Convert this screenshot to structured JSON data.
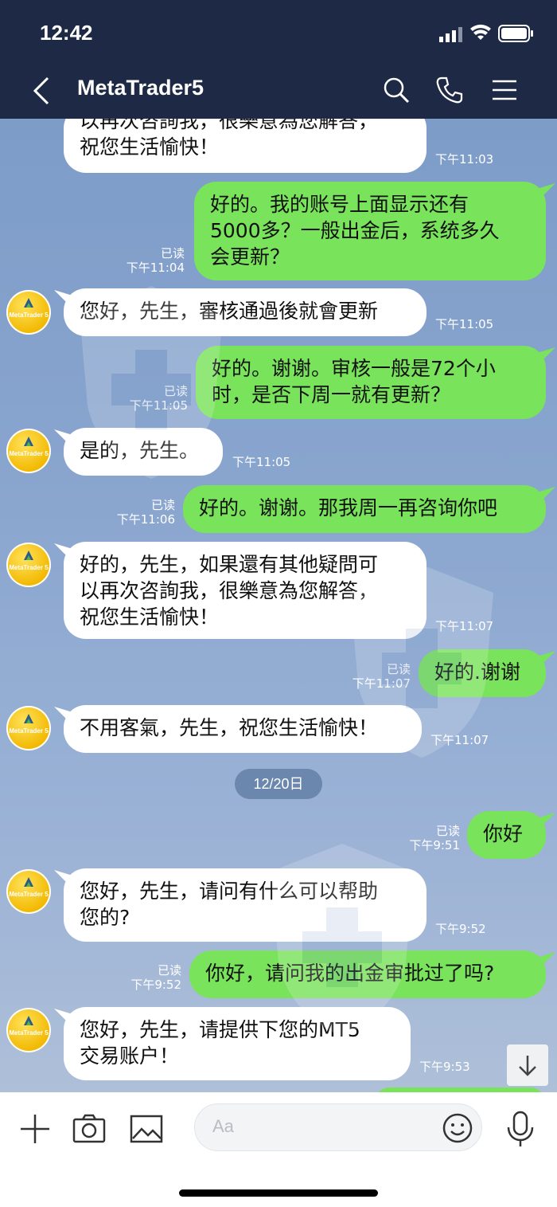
{
  "status_bar": {
    "time": "12:42"
  },
  "header": {
    "title": "MetaTrader5"
  },
  "avatar_text": "MetaTrader 5",
  "messages": [
    {
      "id": 0,
      "side": "in",
      "text": "以再次咨詢我，很樂意為您解答，\n祝您生活愉快！",
      "time": "下午11:03",
      "read": ""
    },
    {
      "id": 1,
      "side": "out",
      "text": "好的。我的账号上面显示还有\n5000多？一般出金后，系统多久\n会更新？",
      "time": "下午11:04",
      "read": "已读"
    },
    {
      "id": 2,
      "side": "in",
      "text": "您好，先生，審核通過後就會更新",
      "time": "下午11:05",
      "read": ""
    },
    {
      "id": 3,
      "side": "out",
      "text": "好的。谢谢。审核一般是72个小\n时，是否下周一就有更新？",
      "time": "下午11:05",
      "read": "已读"
    },
    {
      "id": 4,
      "side": "in",
      "text": "是的，先生。",
      "time": "下午11:05",
      "read": ""
    },
    {
      "id": 5,
      "side": "out",
      "text": "好的。谢谢。那我周一再咨询你吧",
      "time": "下午11:06",
      "read": "已读"
    },
    {
      "id": 6,
      "side": "in",
      "text": "好的，先生，如果還有其他疑問可\n以再次咨詢我，很樂意為您解答，\n祝您生活愉快！",
      "time": "下午11:07",
      "read": ""
    },
    {
      "id": 7,
      "side": "out",
      "text": "好的.谢谢",
      "time": "下午11:07",
      "read": "已读"
    },
    {
      "id": 8,
      "side": "in",
      "text": "不用客氣，先生，祝您生活愉快！",
      "time": "下午11:07",
      "read": ""
    },
    {
      "id": 9,
      "side": "out",
      "text": "你好",
      "time": "下午9:51",
      "read": "已读"
    },
    {
      "id": 10,
      "side": "in",
      "text": "您好，先生，请问有什么可以帮助\n您的?",
      "time": "下午9:52",
      "read": ""
    },
    {
      "id": 11,
      "side": "out",
      "text": "你好，请问我的出金审批过了吗?",
      "time": "下午9:52",
      "read": "已读"
    },
    {
      "id": 12,
      "side": "in",
      "text": "您好，先生，请提供下您的MT5\n交易账户！",
      "time": "下午9:53",
      "read": ""
    }
  ],
  "date_separator": "12/20日",
  "input": {
    "placeholder": "Aa"
  },
  "colors": {
    "header": "#1e2a45",
    "out_bubble": "#79e35b",
    "in_bubble": "#ffffff"
  }
}
